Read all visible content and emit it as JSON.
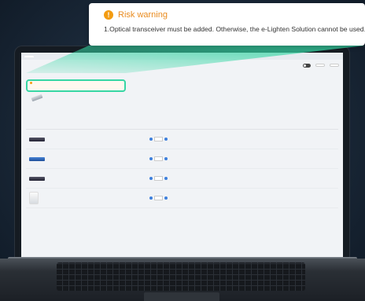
{
  "tooltip": {
    "title": "Risk warning",
    "message": "1.Optical transceiver must be added. Otherwise, the e-Lighten Solution cannot be used."
  },
  "colors": {
    "warning": "#f39c12",
    "highlight": "#36d6a4",
    "accent": "#3d7fdc"
  }
}
